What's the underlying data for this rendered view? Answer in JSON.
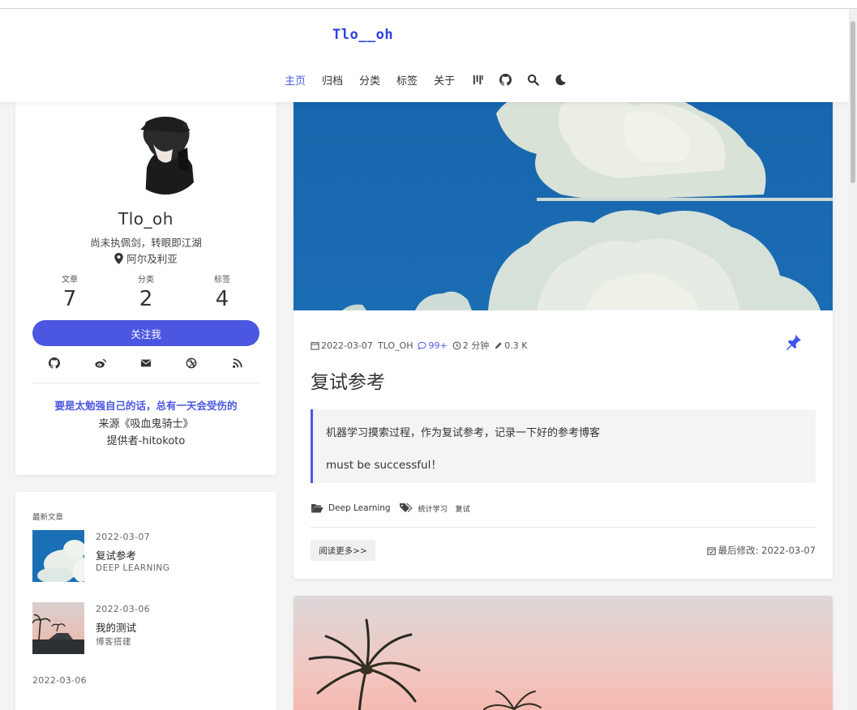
{
  "header": {
    "logo": "Tlo__oh",
    "nav": [
      "主页",
      "归档",
      "分类",
      "标签",
      "关于"
    ],
    "icons": [
      "ios-stats-icon",
      "github-icon",
      "search-icon",
      "moon-icon"
    ]
  },
  "profile": {
    "name": "Tlo_oh",
    "motto": "尚未执佩剑，转眼即江湖",
    "location": "阿尔及利亚",
    "stats": [
      {
        "label": "文章",
        "value": "7"
      },
      {
        "label": "分类",
        "value": "2"
      },
      {
        "label": "标签",
        "value": "4"
      }
    ],
    "follow_label": "关注我",
    "socials": [
      "github-icon",
      "weibo-icon",
      "mail-icon",
      "dribbble-icon",
      "rss-icon"
    ],
    "quote": "要是太勉强自己的话，总有一天会受伤的",
    "source": "来源《吸血鬼骑士》",
    "provider": "提供者-hitokoto"
  },
  "recent": {
    "title": "最新文章",
    "items": [
      {
        "date": "2022-03-07",
        "name": "复试参考",
        "category": "DEEP LEARNING"
      },
      {
        "date": "2022-03-06",
        "name": "我的测试",
        "category": "博客搭建"
      }
    ],
    "extra_date": "2022-03-06"
  },
  "post": {
    "date": "2022-03-07",
    "author": "TLO_OH",
    "comments": "99+",
    "read_time": "2 分钟",
    "words": "0.3 K",
    "title": "复试参考",
    "excerpt_line1": "机器学习摸索过程，作为复试参考，记录一下好的参考博客",
    "excerpt_line2": "must be successful！",
    "category": "Deep Learning",
    "tags": [
      "统计学习",
      "复试"
    ],
    "read_more": "阅读更多>>",
    "modified": "最后修改: 2022-03-07"
  },
  "colors": {
    "accent": "#4b57e0",
    "sky": "#1766ad"
  }
}
